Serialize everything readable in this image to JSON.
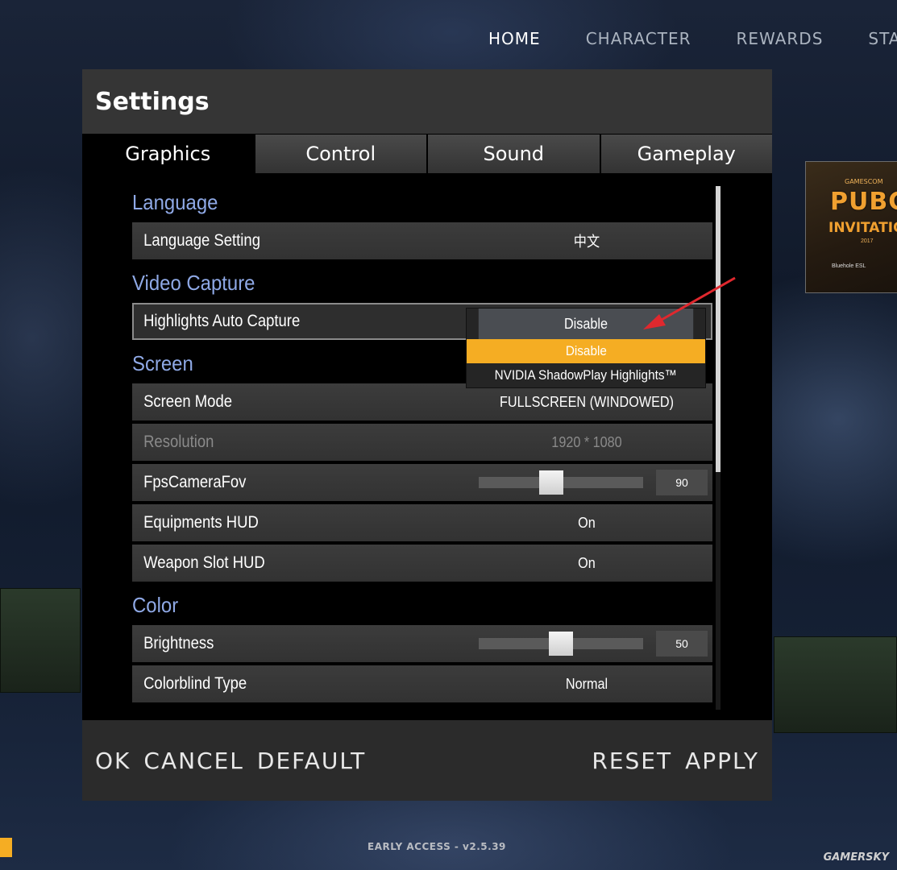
{
  "topnav": {
    "items": [
      {
        "label": "HOME"
      },
      {
        "label": "CHARACTER"
      },
      {
        "label": "REWARDS"
      },
      {
        "label": "STA"
      }
    ]
  },
  "promo": {
    "small": "GAMESCOM",
    "big": "PUBG",
    "sub": "INVITATIONAL",
    "year": "2017",
    "sponsors": "Bluehole  ESL"
  },
  "settings": {
    "title": "Settings",
    "tabs": [
      {
        "label": "Graphics"
      },
      {
        "label": "Control"
      },
      {
        "label": "Sound"
      },
      {
        "label": "Gameplay"
      }
    ],
    "sections": {
      "language": {
        "title": "Language",
        "rows": [
          {
            "label": "Language Setting",
            "value": "中文"
          }
        ]
      },
      "video_capture": {
        "title": "Video Capture",
        "rows": [
          {
            "label": "Highlights Auto Capture",
            "value": "Disable"
          }
        ]
      },
      "screen": {
        "title": "Screen",
        "rows": [
          {
            "label": "Screen Mode",
            "value": "FULLSCREEN (WINDOWED)"
          },
          {
            "label": "Resolution",
            "value": "1920 * 1080"
          },
          {
            "label": "FpsCameraFov",
            "value": "90",
            "slider_fraction": 0.44
          },
          {
            "label": "Equipments HUD",
            "value": "On"
          },
          {
            "label": "Weapon Slot HUD",
            "value": "On"
          }
        ]
      },
      "color": {
        "title": "Color",
        "rows": [
          {
            "label": "Brightness",
            "value": "50",
            "slider_fraction": 0.5
          },
          {
            "label": "Colorblind Type",
            "value": "Normal"
          }
        ]
      }
    },
    "dropdown": {
      "current": "Disable",
      "options": [
        {
          "label": "Disable",
          "highlighted": true
        },
        {
          "label": "NVIDIA ShadowPlay Highlights™",
          "highlighted": false
        }
      ]
    },
    "footer": {
      "left": [
        "OK",
        "CANCEL",
        "DEFAULT"
      ],
      "right": [
        "RESET",
        "APPLY"
      ]
    }
  },
  "version": "EARLY ACCESS - v2.5.39",
  "watermark": "GAMERSKY",
  "colors": {
    "accent": "#f5ad23",
    "section_title": "#8fa9e6",
    "annotation_arrow": "#e0282e"
  }
}
